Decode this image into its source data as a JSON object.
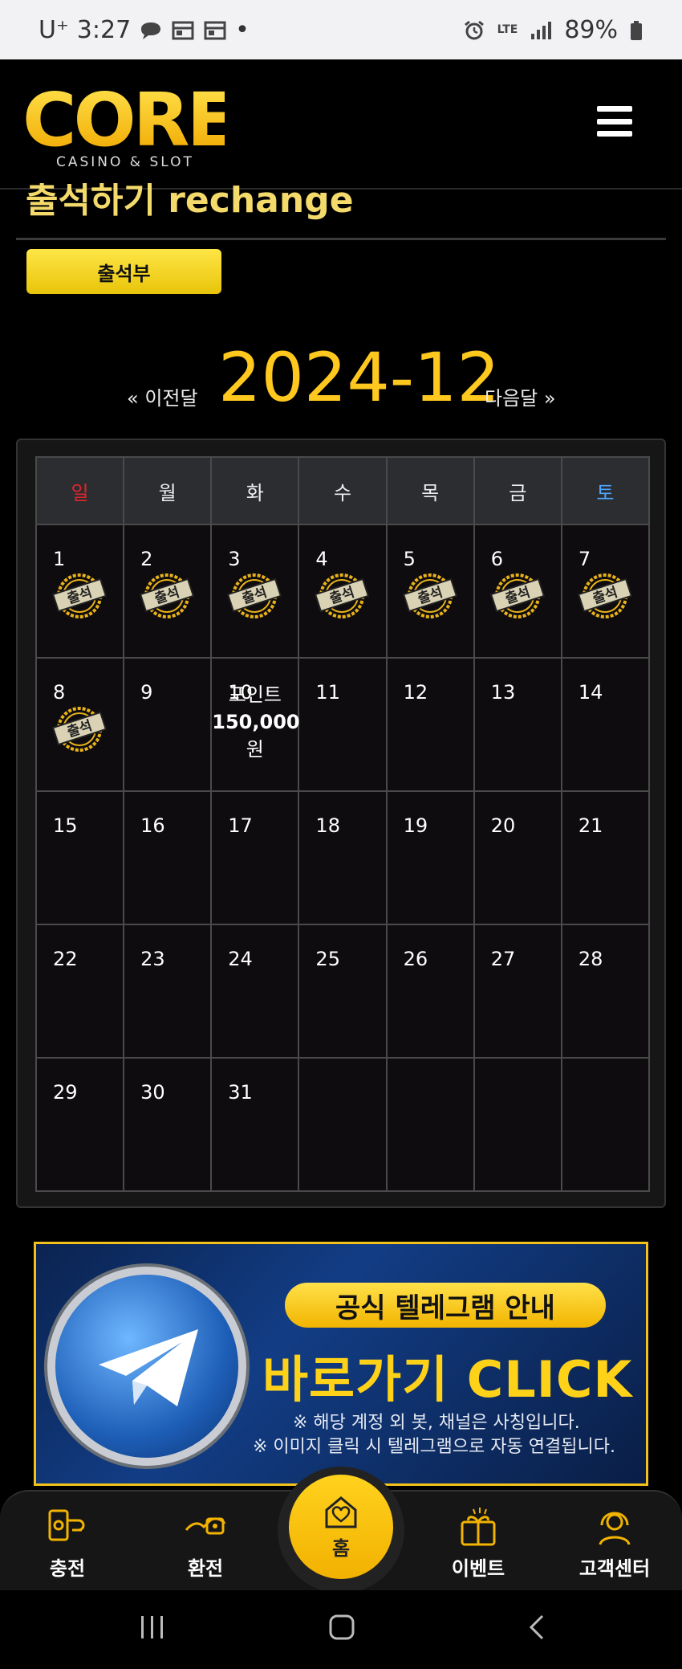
{
  "status_bar": {
    "carrier": "U⁺",
    "time": "3:27",
    "dot": "•",
    "network": "LTE",
    "battery": "89%"
  },
  "header": {
    "logo_text": "CORE",
    "logo_subtitle": "CASINO & SLOT"
  },
  "page": {
    "title": "출석하기 rechange",
    "attend_button": "출석부"
  },
  "calendar": {
    "prev_label": "이전달",
    "next_label": "다음달",
    "month": "2024-12",
    "weekdays": [
      "일",
      "월",
      "화",
      "수",
      "목",
      "금",
      "토"
    ],
    "weeks": [
      [
        "1",
        "2",
        "3",
        "4",
        "5",
        "6",
        "7"
      ],
      [
        "8",
        "9",
        "10",
        "11",
        "12",
        "13",
        "14"
      ],
      [
        "15",
        "16",
        "17",
        "18",
        "19",
        "20",
        "21"
      ],
      [
        "22",
        "23",
        "24",
        "25",
        "26",
        "27",
        "28"
      ],
      [
        "29",
        "30",
        "31",
        "",
        "",
        "",
        ""
      ]
    ],
    "stamp_label": "출석",
    "reward": {
      "line1": "포인트",
      "amount": "150,000",
      "unit": "원"
    },
    "colors": {
      "sunday": "#e0252b",
      "saturday": "#4fa7ff",
      "accent": "#ffc81e"
    }
  },
  "banner": {
    "pill": "공식 텔레그램 안내",
    "cta": "바로가기 CLICK",
    "note1": "※ 해당 계정 외 봇, 채널은 사칭입니다.",
    "note2": "※ 이미지 클릭 시 텔레그램으로 자동 연결됩니다."
  },
  "bottom_nav": {
    "charge": "충전",
    "exchange": "환전",
    "home": "홈",
    "event": "이벤트",
    "support": "고객센터"
  }
}
